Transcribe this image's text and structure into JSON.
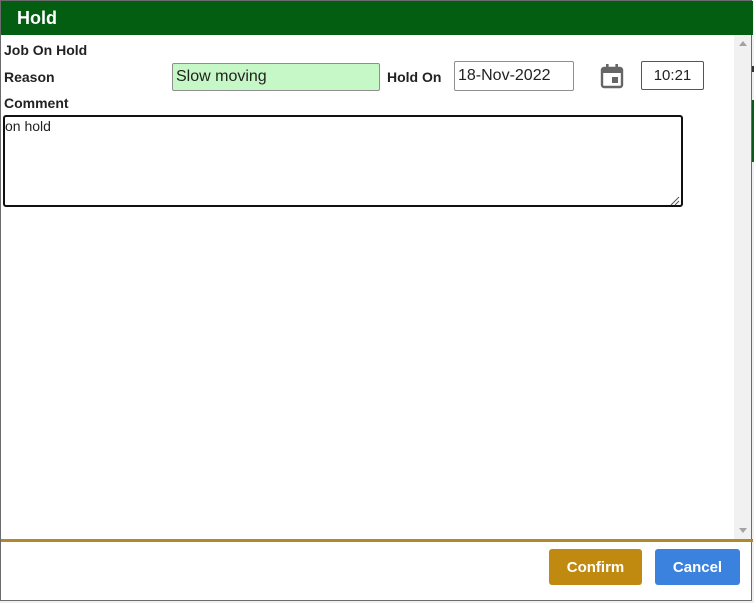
{
  "dialog": {
    "title": "Hold",
    "header_color": "#035e12"
  },
  "form": {
    "job_on_hold_label": "Job On Hold",
    "reason_label": "Reason",
    "reason_value": "Slow moving",
    "hold_on_label": "Hold On",
    "hold_on_date": "18-Nov-2022",
    "hold_on_time": "10:21",
    "comment_label": "Comment",
    "comment_value": "on hold",
    "calendar_icon": "calendar-icon"
  },
  "footer": {
    "confirm_label": "Confirm",
    "cancel_label": "Cancel",
    "confirm_color": "#c08a10",
    "cancel_color": "#3b82df"
  }
}
